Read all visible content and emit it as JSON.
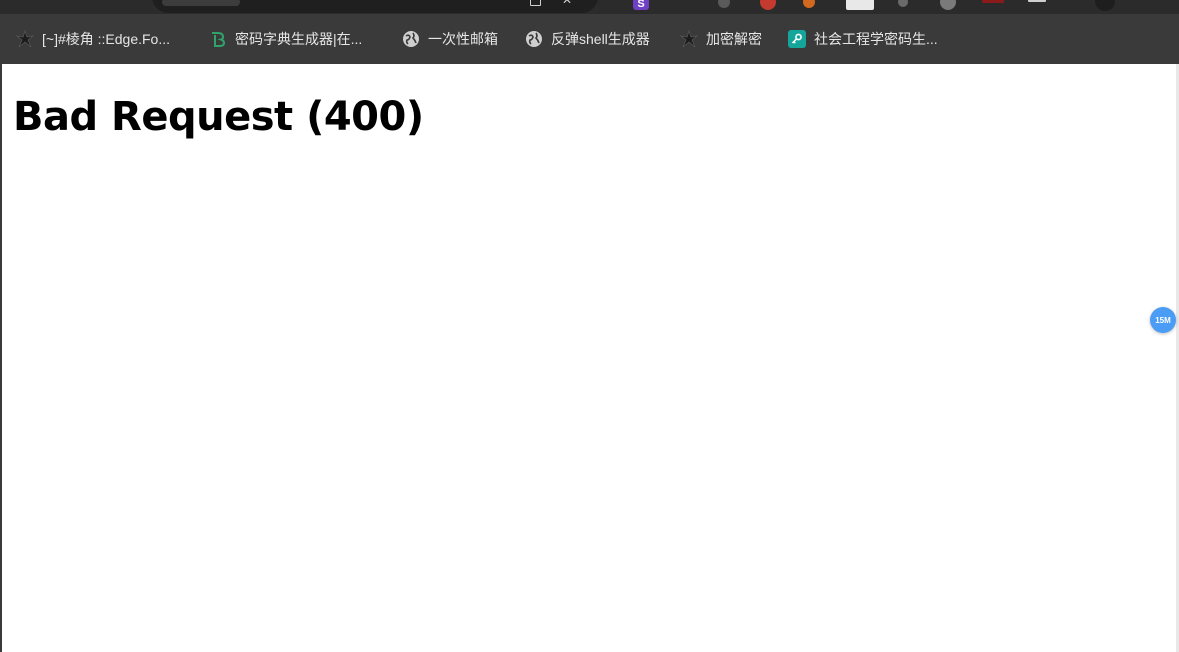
{
  "bookmarks_bar": {
    "items": [
      {
        "label": "[~]#棱角 ::Edge.Fo...",
        "icon": "star-logo-icon"
      },
      {
        "label": "密码字典生成器|在...",
        "icon": "green-b-logo-icon"
      },
      {
        "label": "一次性邮箱",
        "icon": "globe-icon"
      },
      {
        "label": "反弹shell生成器",
        "icon": "globe-icon"
      },
      {
        "label": "加密解密",
        "icon": "star-logo-icon"
      },
      {
        "label": "社会工程学密码生...",
        "icon": "teal-key-icon"
      }
    ]
  },
  "toolbar": {
    "extension_s_label": "S"
  },
  "page": {
    "heading": "Bad Request (400)"
  },
  "floating_badge": {
    "label": "15M",
    "color": "#4a9cf5"
  }
}
